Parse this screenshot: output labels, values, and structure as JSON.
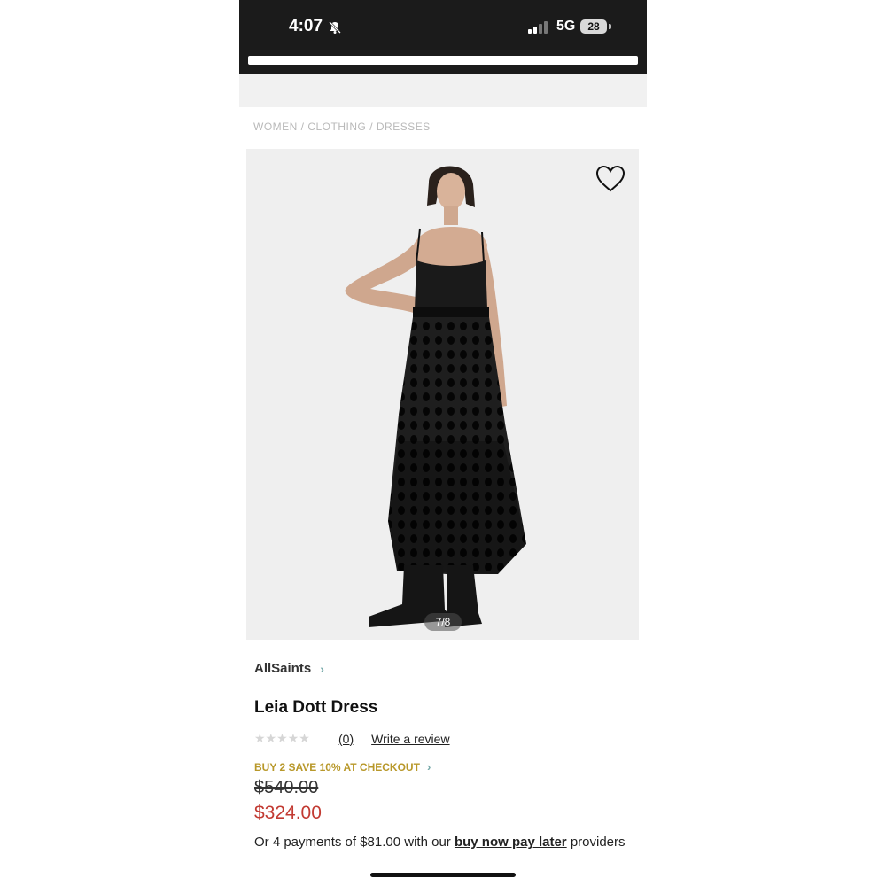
{
  "status_bar": {
    "time": "4:07",
    "network": "5G",
    "battery": "28",
    "icons": [
      "bell-slash-icon",
      "signal-icon",
      "battery-icon"
    ]
  },
  "breadcrumb": {
    "items": [
      "WOMEN",
      "CLOTHING",
      "DRESSES"
    ],
    "separator": "/"
  },
  "gallery": {
    "counter": "7/8",
    "icons": [
      "heart-icon"
    ]
  },
  "product": {
    "brand": "AllSaints",
    "title": "Leia Dott Dress",
    "rating_stars": "★★★★★",
    "review_count": "(0)",
    "write_review": "Write a review",
    "promo": "BUY 2 SAVE 10% AT CHECKOUT",
    "original_price": "$540.00",
    "sale_price": "$324.00",
    "installments_prefix": "Or 4 payments of $81.00 with our ",
    "installments_link": "buy now pay later",
    "installments_suffix": " providers"
  },
  "colors": {
    "status_bar_bg": "#1b1b1b",
    "promo_gold": "#b8982a",
    "sale_red": "#c23a32",
    "breadcrumb_gray": "#b9b9b9"
  }
}
